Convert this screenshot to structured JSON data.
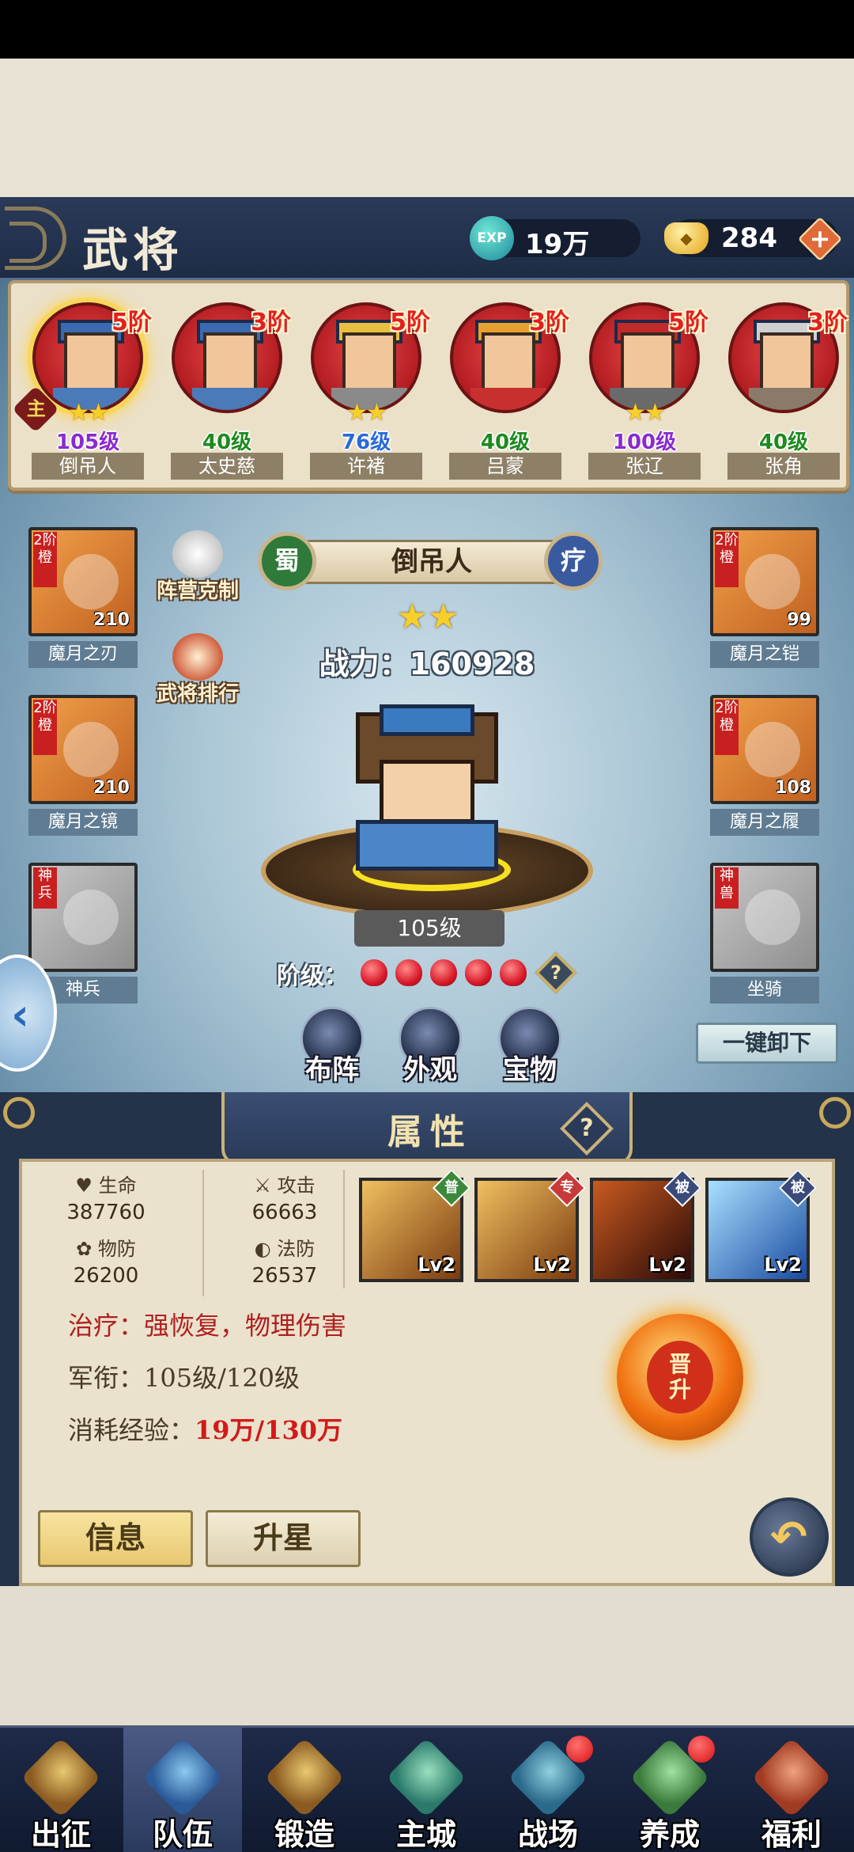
{
  "header": {
    "title": "武将",
    "exp_icon": "EXP",
    "exp_value": "19万",
    "gold_value": "284",
    "plus_label": "+"
  },
  "roster": [
    {
      "rank": "5阶",
      "level": "105级",
      "name": "倒吊人",
      "stars": "★★",
      "level_color": "#8a2ad0",
      "active": true
    },
    {
      "rank": "3阶",
      "level": "40级",
      "name": "太史慈",
      "stars": "",
      "level_color": "#1e8a1e"
    },
    {
      "rank": "5阶",
      "level": "76级",
      "name": "许褚",
      "stars": "★★",
      "level_color": "#2a6ad8"
    },
    {
      "rank": "3阶",
      "level": "40级",
      "name": "吕蒙",
      "stars": "",
      "level_color": "#1e8a1e"
    },
    {
      "rank": "5阶",
      "level": "100级",
      "name": "张辽",
      "stars": "★★",
      "level_color": "#8a2ad0"
    },
    {
      "rank": "3阶",
      "level": "40级",
      "name": "张角",
      "stars": "",
      "level_color": "#1e8a1e"
    }
  ],
  "main_badge": "主",
  "equipment": {
    "weapon": {
      "tier": "2阶橙",
      "count": "210",
      "name": "魔月之刃"
    },
    "mirror": {
      "tier": "2阶橙",
      "count": "210",
      "name": "魔月之镜"
    },
    "divine_weapon": {
      "tier": "神兵",
      "name": "神兵"
    },
    "armor": {
      "tier": "2阶橙",
      "count": "99",
      "name": "魔月之铠"
    },
    "boots": {
      "tier": "2阶橙",
      "count": "108",
      "name": "魔月之履"
    },
    "mount": {
      "tier": "神兽",
      "name": "坐骑"
    }
  },
  "side_buttons": {
    "faction_counter": "阵营克制",
    "hero_ranking": "武将排行"
  },
  "hero": {
    "faction": "蜀",
    "name": "倒吊人",
    "role": "疗",
    "stars": "★★",
    "power": "战力：160928",
    "level": "105级",
    "grade_label": "阶级："
  },
  "action_buttons": {
    "formation": "布阵",
    "appearance": "外观",
    "treasure": "宝物",
    "unequip_all": "一键卸下"
  },
  "attributes": {
    "title": "属性",
    "help": "?",
    "hp_label": "生命",
    "hp_value": "387760",
    "attack_label": "攻击",
    "attack_value": "66663",
    "pdef_label": "物防",
    "pdef_value": "26200",
    "mdef_label": "法防",
    "mdef_value": "26537"
  },
  "skills": [
    {
      "tag": "普",
      "level": "Lv2",
      "tag_color": "#3a8a3a"
    },
    {
      "tag": "专",
      "level": "Lv2",
      "tag_color": "#c83a3a"
    },
    {
      "tag": "被",
      "level": "Lv2",
      "tag_color": "#3a4a7a"
    },
    {
      "tag": "被",
      "level": "Lv2",
      "tag_color": "#3a4a7a"
    }
  ],
  "info": {
    "specialty": "治疗：强恢复，物理伤害",
    "rank_label": "军衔：105级/120级",
    "exp_label": "消耗经验：",
    "exp_value": "19万/130万"
  },
  "promote": {
    "line1": "晋",
    "line2": "升"
  },
  "tabs": {
    "info": "信息",
    "star_up": "升星"
  },
  "nav": [
    {
      "label": "出征",
      "badge": false
    },
    {
      "label": "队伍",
      "badge": false,
      "active": true
    },
    {
      "label": "锻造",
      "badge": false
    },
    {
      "label": "主城",
      "badge": false
    },
    {
      "label": "战场",
      "badge": true
    },
    {
      "label": "养成",
      "badge": true
    },
    {
      "label": "福利",
      "badge": false
    }
  ]
}
